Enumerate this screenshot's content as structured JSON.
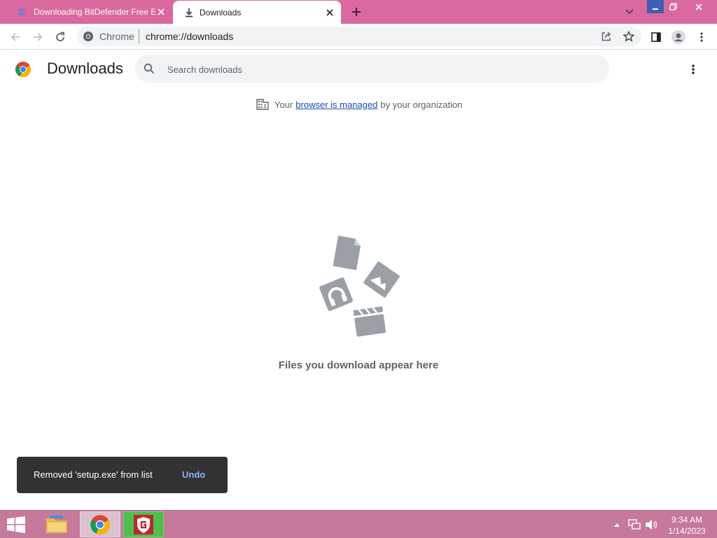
{
  "browser": {
    "tabs": [
      {
        "title": "Downloading BitDefender Free Edition",
        "icon": "bitdefender-favicon",
        "active": false
      },
      {
        "title": "Downloads",
        "icon": "download-icon",
        "active": true
      }
    ],
    "new_tab_icon": "plus-icon",
    "omnibox": {
      "site_label": "Chrome",
      "url": "chrome://downloads"
    }
  },
  "downloads_page": {
    "title": "Downloads",
    "search_placeholder": "Search downloads",
    "managed_notice": {
      "prefix": "Your",
      "link": "browser is managed",
      "suffix": "by your organization"
    },
    "empty_message": "Files you download appear here"
  },
  "toast": {
    "message": "Removed 'setup.exe' from list",
    "action": "Undo"
  },
  "taskbar": {
    "apps": [
      "file-explorer",
      "google-chrome",
      "g-data-antivirus"
    ],
    "clock": {
      "time": "9:34 AM",
      "date": "1/14/2023"
    }
  },
  "colors": {
    "tabbar": "#d9699e",
    "taskbar": "#c6799a",
    "link": "#1a4fb8",
    "toast_bg": "#323232",
    "toast_action": "#8ab4f8"
  }
}
